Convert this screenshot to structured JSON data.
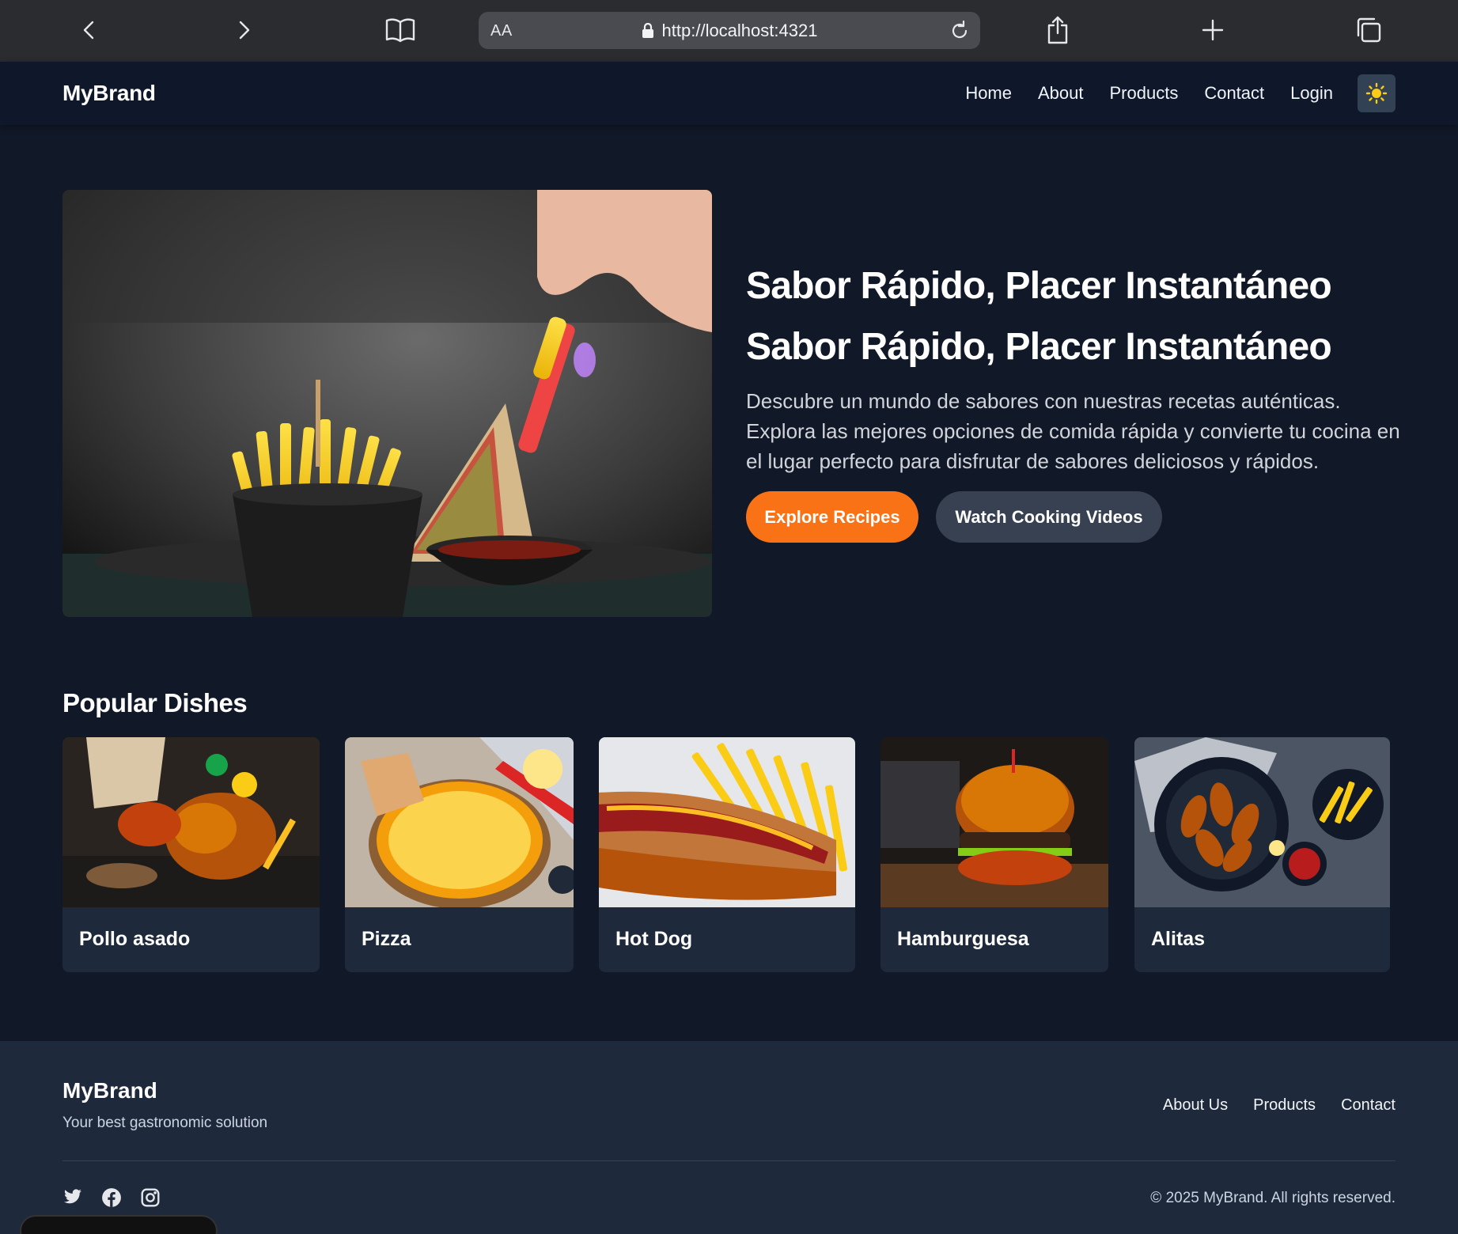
{
  "browser": {
    "aa_label": "AA",
    "url": "http://localhost:4321"
  },
  "navbar": {
    "brand": "MyBrand",
    "links": [
      "Home",
      "About",
      "Products",
      "Contact",
      "Login"
    ],
    "theme_icon": "sun-icon"
  },
  "hero": {
    "title_line_1": "Sabor Rápido, Placer Instantáneo",
    "title_line_2": "Sabor Rápido, Placer Instantáneo",
    "description": "Descubre un mundo de sabores con nuestras recetas auténticas. Explora las mejores opciones de comida rápida y convierte tu cocina en el lugar perfecto para disfrutar de sabores deliciosos y rápidos.",
    "primary_button": "Explore Recipes",
    "secondary_button": "Watch Cooking Videos"
  },
  "popular": {
    "title": "Popular Dishes",
    "dishes": [
      "Pollo asado",
      "Pizza",
      "Hot Dog",
      "Hamburguesa",
      "Alitas"
    ]
  },
  "footer": {
    "brand": "MyBrand",
    "tagline": "Your best gastronomic solution",
    "links": [
      "About Us",
      "Products",
      "Contact"
    ],
    "social_icons": [
      "twitter-icon",
      "facebook-icon",
      "instagram-icon"
    ],
    "copyright": "© 2025 MyBrand. All rights reserved."
  },
  "colors": {
    "page_bg": "#111827",
    "nav_bg": "#0f172a",
    "card_bg": "#1e293b",
    "accent": "#f97316",
    "secondary_button": "#374151",
    "sun": "#facc15"
  }
}
